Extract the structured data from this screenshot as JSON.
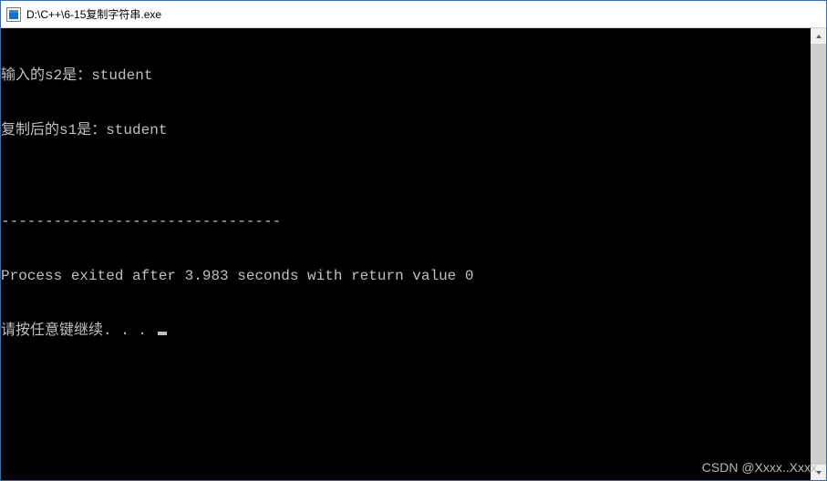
{
  "titlebar": {
    "icon_name": "app-icon",
    "title": "D:\\C++\\6-15复制字符串.exe"
  },
  "console": {
    "line1": "输入的s2是：student",
    "line2": "复制后的s1是：student",
    "blank1": "",
    "separator": "--------------------------------",
    "process_line": "Process exited after 3.983 seconds with return value 0",
    "prompt": "请按任意键继续. . . "
  },
  "watermark": "CSDN @Xxxx..Xxxx"
}
